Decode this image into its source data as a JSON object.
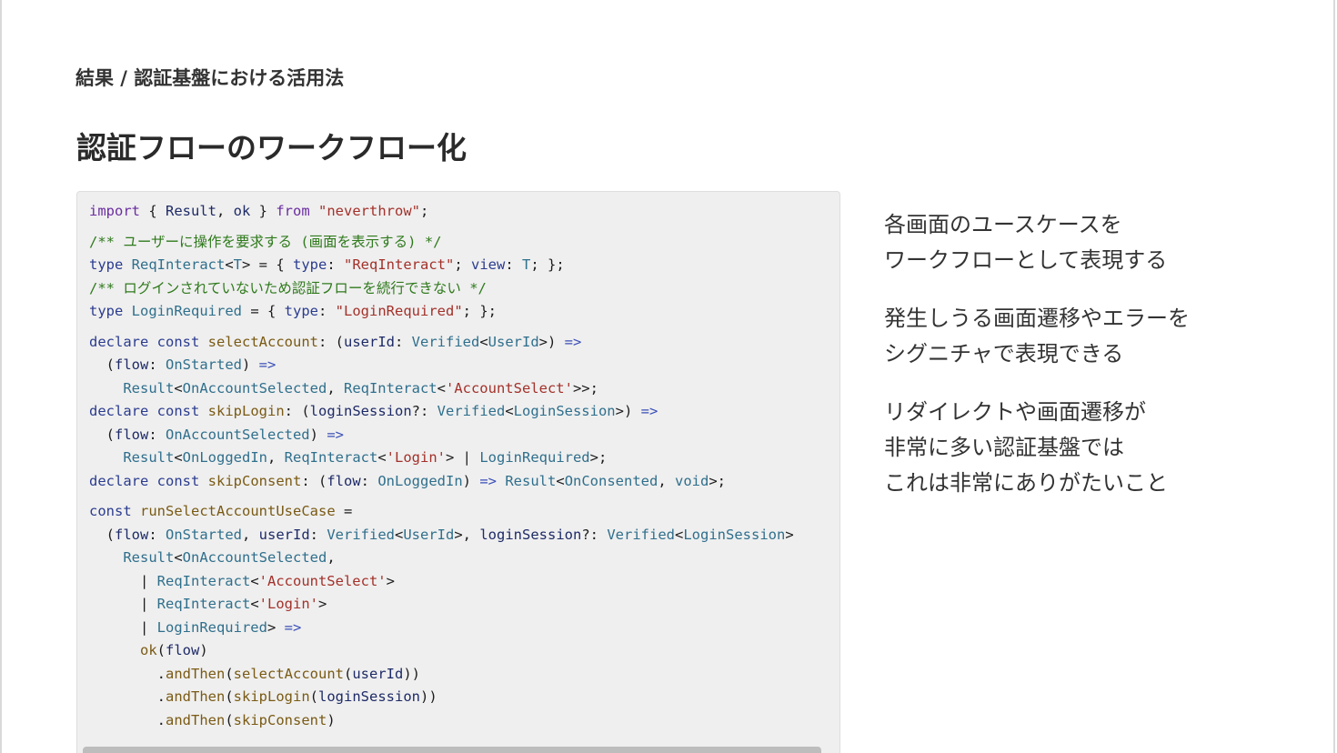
{
  "header": {
    "breadcrumb": "結果 / 認証基盤における活用法",
    "title": "認証フローのワークフロー化"
  },
  "code": {
    "lines": [
      {
        "gap": false,
        "tokens": [
          {
            "t": "import",
            "c": "kw"
          },
          {
            "t": " { ",
            "c": "p"
          },
          {
            "t": "Result",
            "c": "id"
          },
          {
            "t": ", ",
            "c": "p"
          },
          {
            "t": "ok",
            "c": "id"
          },
          {
            "t": " } ",
            "c": "p"
          },
          {
            "t": "from",
            "c": "kw"
          },
          {
            "t": " ",
            "c": "p"
          },
          {
            "t": "\"neverthrow\"",
            "c": "str"
          },
          {
            "t": ";",
            "c": "p"
          }
        ]
      },
      {
        "gap": true,
        "tokens": [
          {
            "t": "/** ユーザーに操作を要求する (画面を表示する) */",
            "c": "cm"
          }
        ]
      },
      {
        "gap": false,
        "tokens": [
          {
            "t": "type",
            "c": "kw2"
          },
          {
            "t": " ",
            "c": "p"
          },
          {
            "t": "ReqInteract",
            "c": "ty"
          },
          {
            "t": "<",
            "c": "p"
          },
          {
            "t": "T",
            "c": "ty"
          },
          {
            "t": "> = { ",
            "c": "p"
          },
          {
            "t": "type",
            "c": "kw2"
          },
          {
            "t": ": ",
            "c": "p"
          },
          {
            "t": "\"ReqInteract\"",
            "c": "str"
          },
          {
            "t": "; ",
            "c": "p"
          },
          {
            "t": "view",
            "c": "kw2"
          },
          {
            "t": ": ",
            "c": "p"
          },
          {
            "t": "T",
            "c": "ty"
          },
          {
            "t": "; };",
            "c": "p"
          }
        ]
      },
      {
        "gap": false,
        "tokens": [
          {
            "t": "/** ログインされていないため認証フローを続行できない */",
            "c": "cm"
          }
        ]
      },
      {
        "gap": false,
        "tokens": [
          {
            "t": "type",
            "c": "kw2"
          },
          {
            "t": " ",
            "c": "p"
          },
          {
            "t": "LoginRequired",
            "c": "ty"
          },
          {
            "t": " = { ",
            "c": "p"
          },
          {
            "t": "type",
            "c": "kw2"
          },
          {
            "t": ": ",
            "c": "p"
          },
          {
            "t": "\"LoginRequired\"",
            "c": "str"
          },
          {
            "t": "; };",
            "c": "p"
          }
        ]
      },
      {
        "gap": true,
        "tokens": [
          {
            "t": "declare const",
            "c": "kw2"
          },
          {
            "t": " ",
            "c": "p"
          },
          {
            "t": "selectAccount",
            "c": "fn"
          },
          {
            "t": ": (",
            "c": "p"
          },
          {
            "t": "userId",
            "c": "id"
          },
          {
            "t": ": ",
            "c": "p"
          },
          {
            "t": "Verified",
            "c": "ty"
          },
          {
            "t": "<",
            "c": "p"
          },
          {
            "t": "UserId",
            "c": "ty"
          },
          {
            "t": ">) ",
            "c": "p"
          },
          {
            "t": "=>",
            "c": "op"
          }
        ]
      },
      {
        "gap": false,
        "tokens": [
          {
            "t": "  (",
            "c": "p"
          },
          {
            "t": "flow",
            "c": "id"
          },
          {
            "t": ": ",
            "c": "p"
          },
          {
            "t": "OnStarted",
            "c": "ty"
          },
          {
            "t": ") ",
            "c": "p"
          },
          {
            "t": "=>",
            "c": "op"
          }
        ]
      },
      {
        "gap": false,
        "tokens": [
          {
            "t": "    ",
            "c": "p"
          },
          {
            "t": "Result",
            "c": "ty"
          },
          {
            "t": "<",
            "c": "p"
          },
          {
            "t": "OnAccountSelected",
            "c": "ty"
          },
          {
            "t": ", ",
            "c": "p"
          },
          {
            "t": "ReqInteract",
            "c": "ty"
          },
          {
            "t": "<",
            "c": "p"
          },
          {
            "t": "'AccountSelect'",
            "c": "str"
          },
          {
            "t": ">>;",
            "c": "p"
          }
        ]
      },
      {
        "gap": false,
        "tokens": [
          {
            "t": "declare const",
            "c": "kw2"
          },
          {
            "t": " ",
            "c": "p"
          },
          {
            "t": "skipLogin",
            "c": "fn"
          },
          {
            "t": ": (",
            "c": "p"
          },
          {
            "t": "loginSession",
            "c": "id"
          },
          {
            "t": "?: ",
            "c": "p"
          },
          {
            "t": "Verified",
            "c": "ty"
          },
          {
            "t": "<",
            "c": "p"
          },
          {
            "t": "LoginSession",
            "c": "ty"
          },
          {
            "t": ">) ",
            "c": "p"
          },
          {
            "t": "=>",
            "c": "op"
          }
        ]
      },
      {
        "gap": false,
        "tokens": [
          {
            "t": "  (",
            "c": "p"
          },
          {
            "t": "flow",
            "c": "id"
          },
          {
            "t": ": ",
            "c": "p"
          },
          {
            "t": "OnAccountSelected",
            "c": "ty"
          },
          {
            "t": ") ",
            "c": "p"
          },
          {
            "t": "=>",
            "c": "op"
          }
        ]
      },
      {
        "gap": false,
        "tokens": [
          {
            "t": "    ",
            "c": "p"
          },
          {
            "t": "Result",
            "c": "ty"
          },
          {
            "t": "<",
            "c": "p"
          },
          {
            "t": "OnLoggedIn",
            "c": "ty"
          },
          {
            "t": ", ",
            "c": "p"
          },
          {
            "t": "ReqInteract",
            "c": "ty"
          },
          {
            "t": "<",
            "c": "p"
          },
          {
            "t": "'Login'",
            "c": "str"
          },
          {
            "t": "> | ",
            "c": "p"
          },
          {
            "t": "LoginRequired",
            "c": "ty"
          },
          {
            "t": ">;",
            "c": "p"
          }
        ]
      },
      {
        "gap": false,
        "tokens": [
          {
            "t": "declare const",
            "c": "kw2"
          },
          {
            "t": " ",
            "c": "p"
          },
          {
            "t": "skipConsent",
            "c": "fn"
          },
          {
            "t": ": (",
            "c": "p"
          },
          {
            "t": "flow",
            "c": "id"
          },
          {
            "t": ": ",
            "c": "p"
          },
          {
            "t": "OnLoggedIn",
            "c": "ty"
          },
          {
            "t": ") ",
            "c": "p"
          },
          {
            "t": "=>",
            "c": "op"
          },
          {
            "t": " ",
            "c": "p"
          },
          {
            "t": "Result",
            "c": "ty"
          },
          {
            "t": "<",
            "c": "p"
          },
          {
            "t": "OnConsented",
            "c": "ty"
          },
          {
            "t": ", ",
            "c": "p"
          },
          {
            "t": "void",
            "c": "ty"
          },
          {
            "t": ">;",
            "c": "p"
          }
        ]
      },
      {
        "gap": true,
        "tokens": [
          {
            "t": "const",
            "c": "kw2"
          },
          {
            "t": " ",
            "c": "p"
          },
          {
            "t": "runSelectAccountUseCase",
            "c": "fn"
          },
          {
            "t": " =",
            "c": "p"
          }
        ]
      },
      {
        "gap": false,
        "tokens": [
          {
            "t": "  (",
            "c": "p"
          },
          {
            "t": "flow",
            "c": "id"
          },
          {
            "t": ": ",
            "c": "p"
          },
          {
            "t": "OnStarted",
            "c": "ty"
          },
          {
            "t": ", ",
            "c": "p"
          },
          {
            "t": "userId",
            "c": "id"
          },
          {
            "t": ": ",
            "c": "p"
          },
          {
            "t": "Verified",
            "c": "ty"
          },
          {
            "t": "<",
            "c": "p"
          },
          {
            "t": "UserId",
            "c": "ty"
          },
          {
            "t": ">, ",
            "c": "p"
          },
          {
            "t": "loginSession",
            "c": "id"
          },
          {
            "t": "?: ",
            "c": "p"
          },
          {
            "t": "Verified",
            "c": "ty"
          },
          {
            "t": "<",
            "c": "p"
          },
          {
            "t": "LoginSession",
            "c": "ty"
          },
          {
            "t": ">",
            "c": "p"
          }
        ]
      },
      {
        "gap": false,
        "tokens": [
          {
            "t": "    ",
            "c": "p"
          },
          {
            "t": "Result",
            "c": "ty"
          },
          {
            "t": "<",
            "c": "p"
          },
          {
            "t": "OnAccountSelected",
            "c": "ty"
          },
          {
            "t": ",",
            "c": "p"
          }
        ]
      },
      {
        "gap": false,
        "tokens": [
          {
            "t": "      | ",
            "c": "p"
          },
          {
            "t": "ReqInteract",
            "c": "ty"
          },
          {
            "t": "<",
            "c": "p"
          },
          {
            "t": "'AccountSelect'",
            "c": "str"
          },
          {
            "t": ">",
            "c": "p"
          }
        ]
      },
      {
        "gap": false,
        "tokens": [
          {
            "t": "      | ",
            "c": "p"
          },
          {
            "t": "ReqInteract",
            "c": "ty"
          },
          {
            "t": "<",
            "c": "p"
          },
          {
            "t": "'Login'",
            "c": "str"
          },
          {
            "t": ">",
            "c": "p"
          }
        ]
      },
      {
        "gap": false,
        "tokens": [
          {
            "t": "      | ",
            "c": "p"
          },
          {
            "t": "LoginRequired",
            "c": "ty"
          },
          {
            "t": "> ",
            "c": "p"
          },
          {
            "t": "=>",
            "c": "op"
          }
        ]
      },
      {
        "gap": false,
        "tokens": [
          {
            "t": "      ",
            "c": "p"
          },
          {
            "t": "ok",
            "c": "fn"
          },
          {
            "t": "(",
            "c": "p"
          },
          {
            "t": "flow",
            "c": "id"
          },
          {
            "t": ")",
            "c": "p"
          }
        ]
      },
      {
        "gap": false,
        "tokens": [
          {
            "t": "        .",
            "c": "p"
          },
          {
            "t": "andThen",
            "c": "fn"
          },
          {
            "t": "(",
            "c": "p"
          },
          {
            "t": "selectAccount",
            "c": "fn"
          },
          {
            "t": "(",
            "c": "p"
          },
          {
            "t": "userId",
            "c": "id"
          },
          {
            "t": "))",
            "c": "p"
          }
        ]
      },
      {
        "gap": false,
        "tokens": [
          {
            "t": "        .",
            "c": "p"
          },
          {
            "t": "andThen",
            "c": "fn"
          },
          {
            "t": "(",
            "c": "p"
          },
          {
            "t": "skipLogin",
            "c": "fn"
          },
          {
            "t": "(",
            "c": "p"
          },
          {
            "t": "loginSession",
            "c": "id"
          },
          {
            "t": "))",
            "c": "p"
          }
        ]
      },
      {
        "gap": false,
        "tokens": [
          {
            "t": "        .",
            "c": "p"
          },
          {
            "t": "andThen",
            "c": "fn"
          },
          {
            "t": "(",
            "c": "p"
          },
          {
            "t": "skipConsent",
            "c": "fn"
          },
          {
            "t": ")",
            "c": "p"
          }
        ]
      }
    ]
  },
  "notes": [
    {
      "lines": [
        "各画面のユースケースを",
        "ワークフローとして表現する"
      ]
    },
    {
      "lines": [
        "発生しうる画面遷移やエラーを",
        "シグニチャで表現できる"
      ]
    },
    {
      "lines": [
        "リダイレクトや画面遷移が",
        "非常に多い認証基盤では",
        "これは非常にありがたいこと"
      ]
    }
  ]
}
